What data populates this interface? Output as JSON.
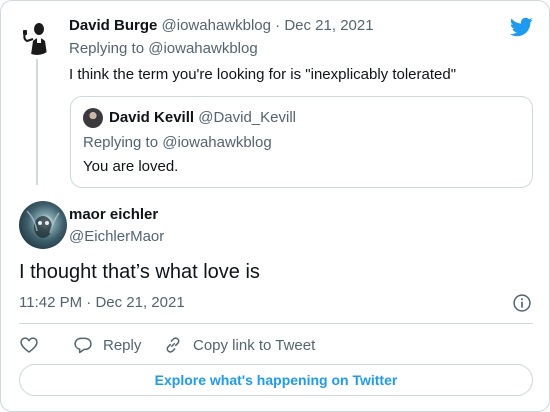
{
  "parent": {
    "name": "David Burge",
    "handle": "@iowahawkblog",
    "separator": "·",
    "date": "Dec 21, 2021",
    "replying_prefix": "Replying to ",
    "replying_to": "@iowahawkblog",
    "text": "I think the term you're looking for is \"inexplicably tolerated\""
  },
  "quote": {
    "name": "David Kevill",
    "handle": "@David_Kevill",
    "replying_prefix": "Replying to ",
    "replying_to": "@iowahawkblog",
    "text": "You are loved."
  },
  "main": {
    "name": "maor eichler",
    "handle": "@EichlerMaor",
    "text": "I thought that’s what love is",
    "time": "11:42 PM",
    "separator": "·",
    "date": "Dec 21, 2021"
  },
  "actions": {
    "like_icon": "heart-icon",
    "reply_label": "Reply",
    "copy_label": "Copy link to Tweet"
  },
  "explore_label": "Explore what's happening on Twitter",
  "colors": {
    "accent": "#1d9bf0",
    "text": "#0f1419",
    "muted": "#536471",
    "border": "#cfd9de"
  }
}
